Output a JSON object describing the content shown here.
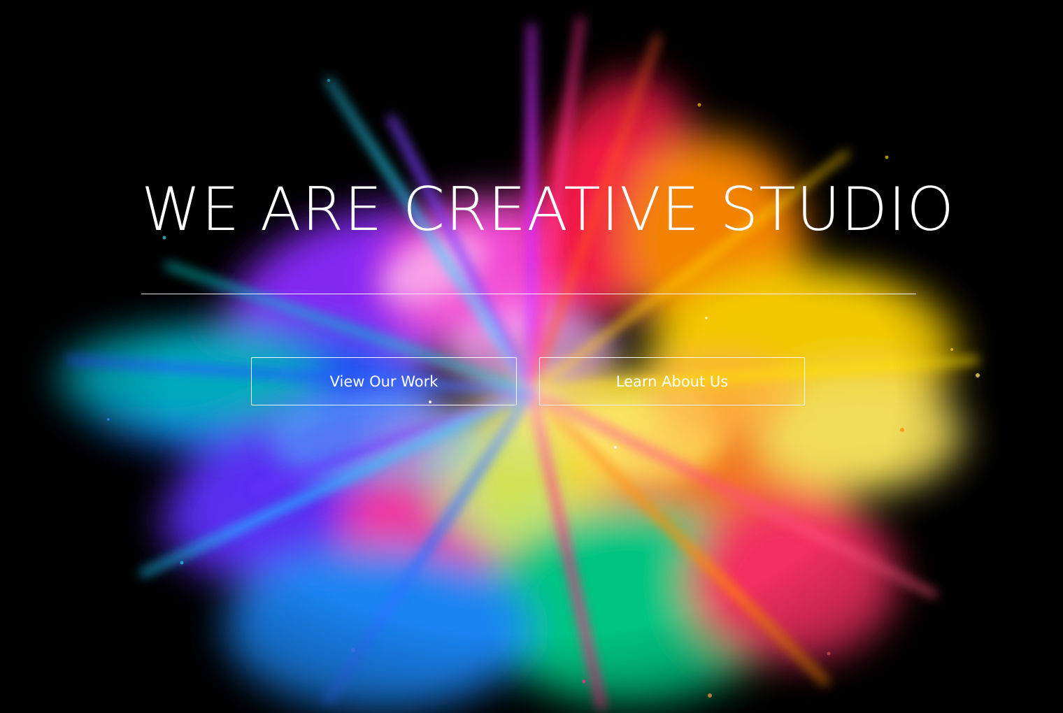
{
  "hero": {
    "headline": "WE ARE CREATIVE STUDIO",
    "background_image": "colorful-powder-explosion",
    "colors": {
      "background": "#000000",
      "text": "#ffffff",
      "button_border": "#ffffff",
      "divider": "#ffffff"
    }
  },
  "buttons": {
    "view_work": "View Our Work",
    "learn_about": "Learn About Us"
  }
}
